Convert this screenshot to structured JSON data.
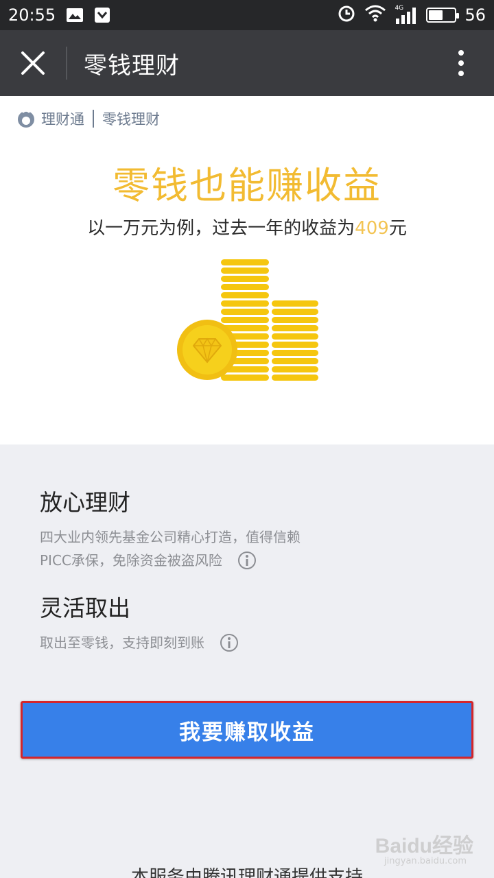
{
  "status_bar": {
    "time": "20:55",
    "network": "4G",
    "battery": "56",
    "battery_level": 0.56
  },
  "nav": {
    "title": "零钱理财"
  },
  "brand": {
    "name": "理财通",
    "section": "零钱理财"
  },
  "hero": {
    "headline": "零钱也能赚收益",
    "sub_prefix": "以一万元为例，过去一年的收益为",
    "sub_amount": "409",
    "sub_suffix": "元"
  },
  "features": [
    {
      "title": "放心理财",
      "lines": [
        "四大业内领先基金公司精心打造，值得信赖",
        "PICC承保，免除资金被盗风险"
      ]
    },
    {
      "title": "灵活取出",
      "lines": [
        "取出至零钱，支持即刻到账"
      ]
    }
  ],
  "cta": {
    "label": "我要赚取收益"
  },
  "footer": {
    "text": "本服务由腾讯理财通提供支持"
  },
  "watermark": {
    "text": "Baidu经验",
    "sub": "jingyan.baidu.com"
  },
  "colors": {
    "accent_gold": "#f2bb32",
    "cta_blue": "#3780e9",
    "status_bar": "#262729",
    "nav_bar": "#3a3b3f"
  }
}
